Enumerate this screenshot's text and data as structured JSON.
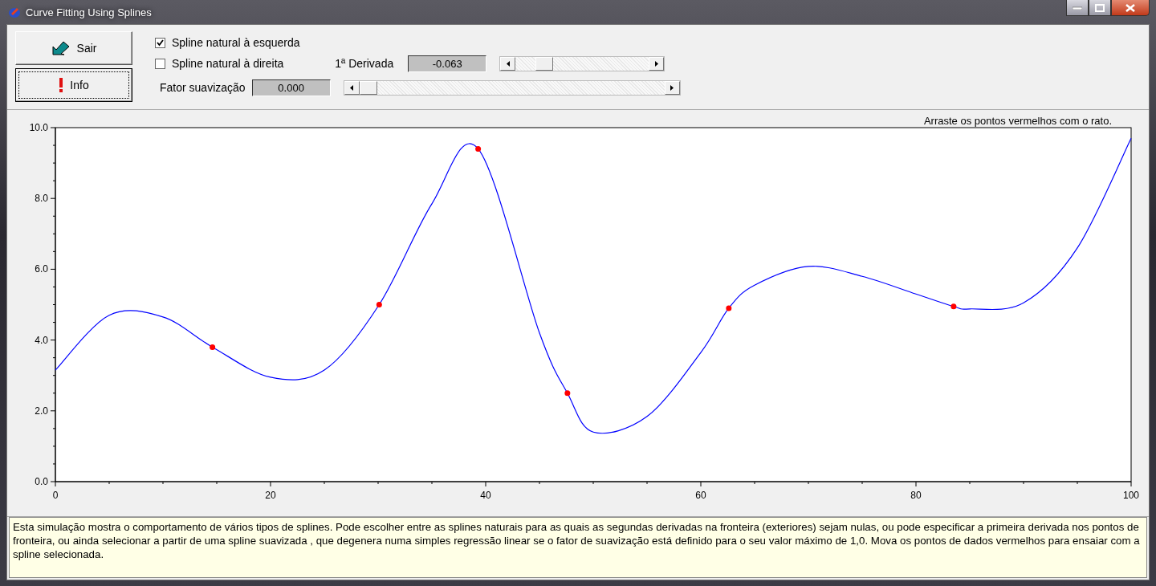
{
  "window": {
    "title": "Curve Fitting Using Splines"
  },
  "buttons": [
    {
      "label": "Sair",
      "kind": "exit",
      "focused": false
    },
    {
      "label": "Info",
      "kind": "info",
      "focused": true
    }
  ],
  "options": [
    {
      "label": "Spline natural à esquerda",
      "checked": true
    },
    {
      "label": "Spline natural à direita",
      "checked": false
    }
  ],
  "derivative": {
    "label": "1ª Derivada",
    "value": "-0.063",
    "level": 0.18
  },
  "smoothing": {
    "label": "Fator suavização",
    "value": "0.000",
    "level": 0
  },
  "chart": {
    "hint": "Arraste os pontos vermelhos com o rato.",
    "chart_data": {
      "type": "line",
      "x": [
        0,
        5,
        10,
        14.6,
        20,
        25,
        30.1,
        35,
        39.3,
        45,
        47.6,
        50,
        55,
        60,
        62.6,
        65,
        70,
        75,
        80,
        83.5,
        85,
        90,
        95,
        100
      ],
      "series": [
        {
          "color": "#0000ff",
          "values": [
            3.15,
            4.7,
            4.65,
            3.8,
            2.95,
            3.15,
            5.0,
            7.85,
            9.4,
            4.2,
            2.5,
            1.4,
            1.84,
            3.65,
            4.9,
            5.55,
            6.08,
            5.8,
            5.3,
            4.95,
            4.88,
            5.05,
            6.6,
            9.7
          ]
        },
        {
          "type": "scatter",
          "color": "#ff0000",
          "values": [
            null,
            null,
            null,
            3.8,
            null,
            null,
            5.0,
            null,
            9.4,
            null,
            2.5,
            null,
            null,
            null,
            4.9,
            null,
            null,
            null,
            null,
            4.95,
            null,
            null,
            null,
            null
          ]
        }
      ],
      "xlim": [
        0,
        100
      ],
      "ylim": [
        0,
        10
      ],
      "xticks": [
        0,
        20,
        40,
        60,
        80,
        100
      ],
      "yticks": [
        {
          "value": 0,
          "label": "0.0"
        },
        {
          "value": 2,
          "label": "2.0"
        },
        {
          "value": 4,
          "label": "4.0"
        },
        {
          "value": 6,
          "label": "6.0"
        },
        {
          "value": 8,
          "label": "8.0"
        },
        {
          "value": 10,
          "label": "10.0"
        }
      ]
    }
  },
  "description": "Esta simulação mostra o comportamento de vários tipos de splines. Pode escolher entre as splines naturais para as quais as segundas derivadas na fronteira (exteriores) sejam nulas, ou pode especificar a primeira derivada nos pontos de fronteira, ou ainda selecionar a partir de uma spline suavizada , que degenera numa simples regressão linear se o fator de suavização está definido para o seu valor máximo de 1,0. Mova os pontos de dados vermelhos para ensaiar com a spline selecionada."
}
